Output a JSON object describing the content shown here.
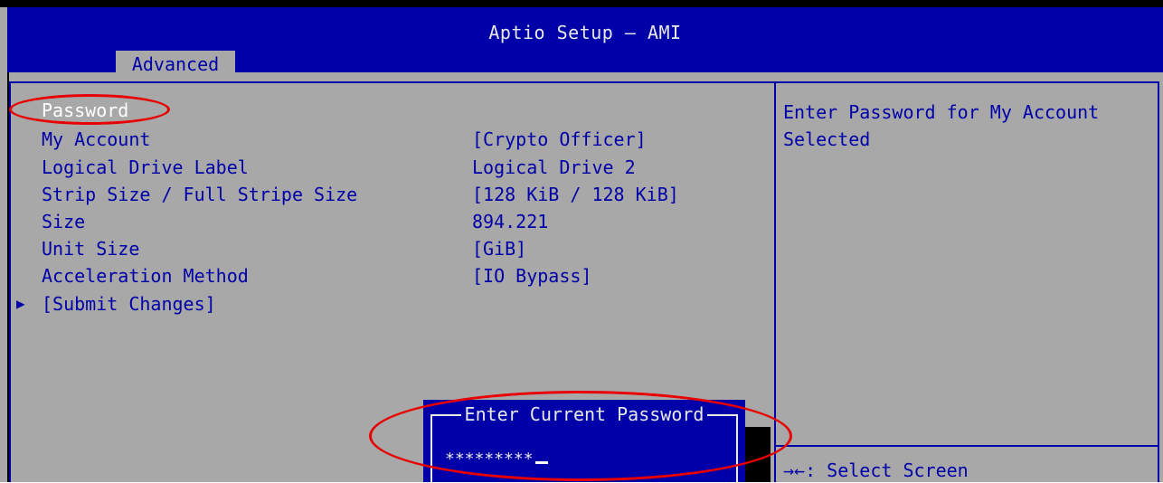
{
  "window": {
    "title": "Aptio Setup – AMI"
  },
  "tabs": [
    {
      "label": "Advanced"
    }
  ],
  "settings": [
    {
      "label": "Password",
      "value": ""
    },
    {
      "label": "My Account",
      "value": "[Crypto Officer]"
    },
    {
      "label": "Logical Drive Label",
      "value": "Logical Drive 2"
    },
    {
      "label": "Strip Size / Full Stripe Size",
      "value": "[128 KiB / 128 KiB]"
    },
    {
      "label": "Size",
      "value": "894.221"
    },
    {
      "label": "Unit Size",
      "value": "[GiB]"
    },
    {
      "label": "Acceleration Method",
      "value": "[IO Bypass]"
    },
    {
      "label": "[Submit Changes]",
      "value": ""
    }
  ],
  "help": {
    "line1": "Enter Password for My Account",
    "line2": "Selected",
    "key_hint": "→←: Select Screen"
  },
  "dialog": {
    "title": "Enter Current Password",
    "input_value": "*********"
  },
  "colors": {
    "header_bg": "#0000a8",
    "panel_bg": "#a8a8a8",
    "text": "#0000a8",
    "highlight": "#ffffff",
    "annotation": "#e80000"
  }
}
